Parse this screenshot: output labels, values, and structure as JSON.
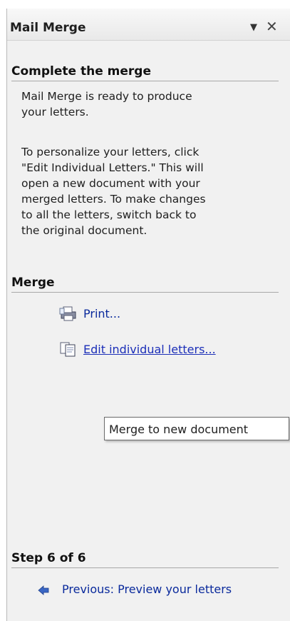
{
  "pane": {
    "title": "Mail Merge",
    "menu_glyph": "▼",
    "close_glyph": "✕"
  },
  "complete": {
    "heading": "Complete the merge",
    "para1_line1": "Mail Merge is ready to produce",
    "para1_line2": "your letters.",
    "para2_lines": [
      "To personalize your letters, click",
      "\"Edit Individual Letters.\" This will",
      "open a new document with your",
      "merged letters. To make changes",
      "to all the letters, switch back to",
      "the original document."
    ]
  },
  "merge": {
    "heading": "Merge",
    "print_label": "Print...",
    "edit_label": "Edit individual letters...",
    "tooltip": "Merge to new document"
  },
  "step": {
    "heading": "Step 6 of 6",
    "previous_label": "Previous: Preview your letters"
  },
  "icons": {
    "print": "printer-icon",
    "edit": "edit-letters-icon",
    "previous": "back-arrow-icon"
  }
}
